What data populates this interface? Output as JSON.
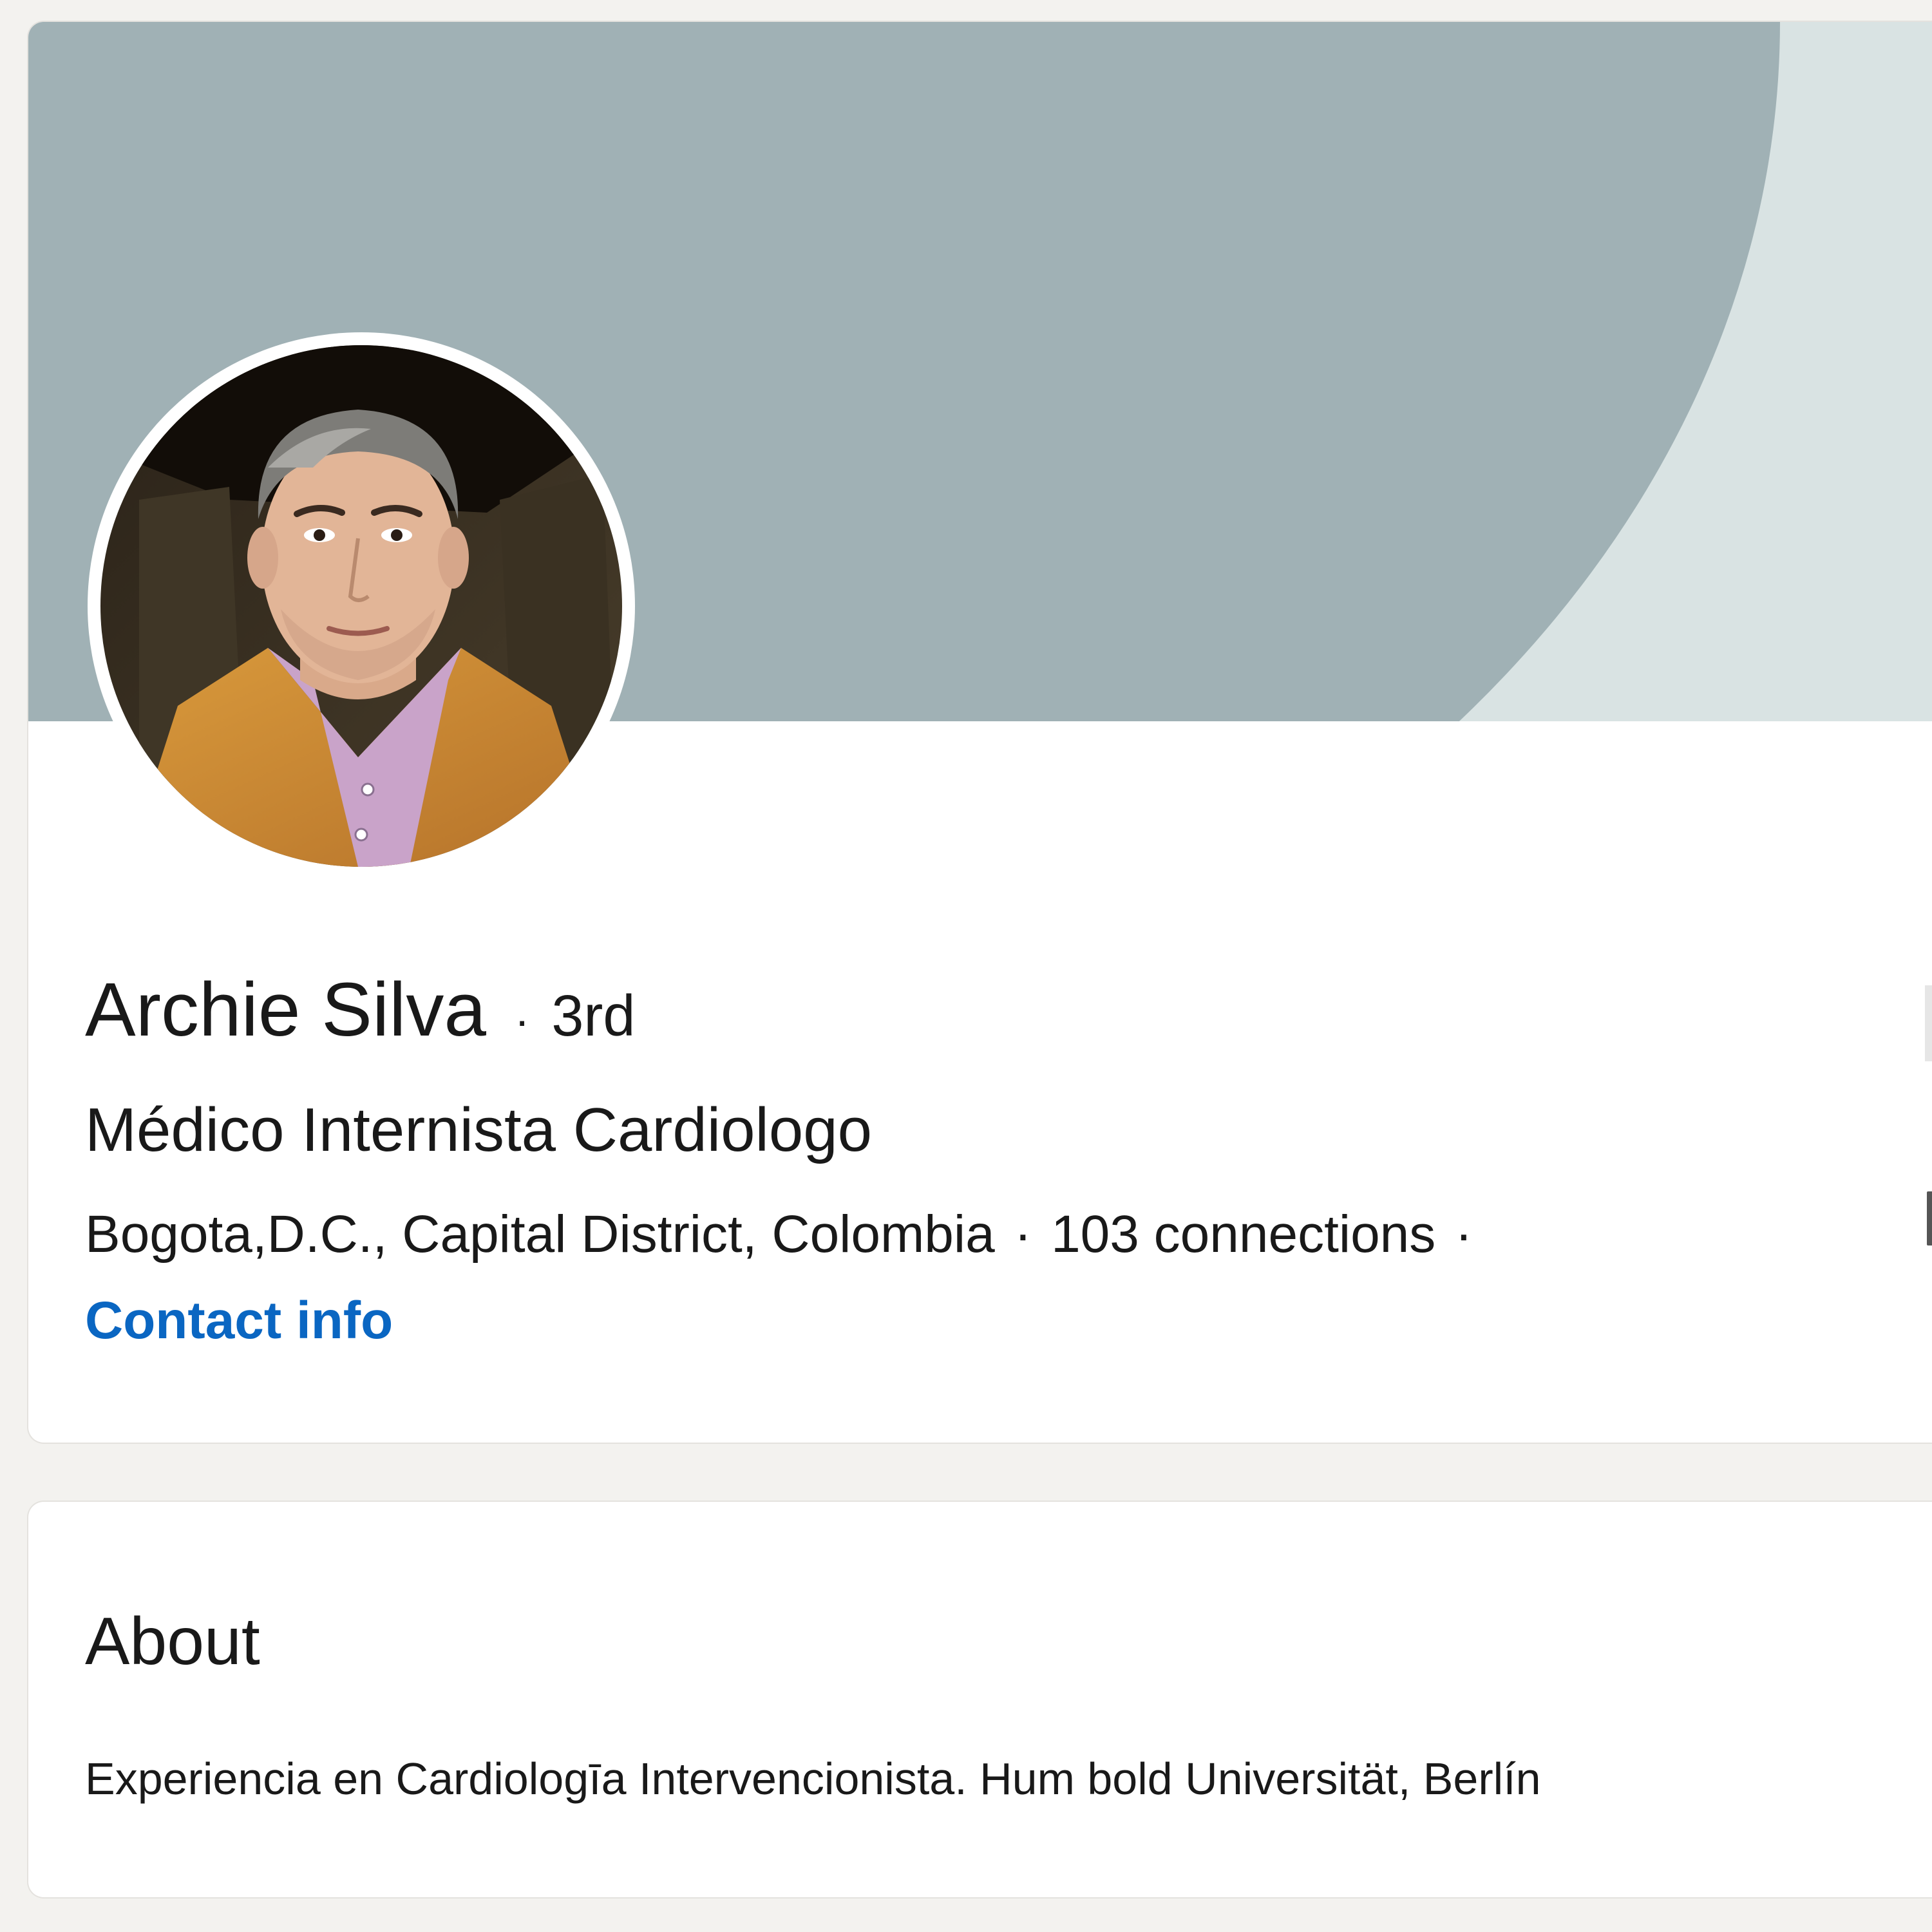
{
  "profile": {
    "name": "Archie Silva",
    "separator": "·",
    "degree": "3rd",
    "headline": "Médico Internista Cardiologo",
    "location": "Bogota,D.C., Capital District, Colombia",
    "connections": "103 connections",
    "contact_info_label": "Contact info",
    "avatar": "profile-photo"
  },
  "about": {
    "title": "About",
    "text": "Experiencia en Cardiologīa Intervencionista. Hum bold Universität, Berlín"
  },
  "colors": {
    "page_background": "#f3f2ef",
    "banner_dark": "#a0b1b5",
    "banner_light": "#d9e3e3",
    "link": "#0a66c2",
    "text": "#191919"
  }
}
